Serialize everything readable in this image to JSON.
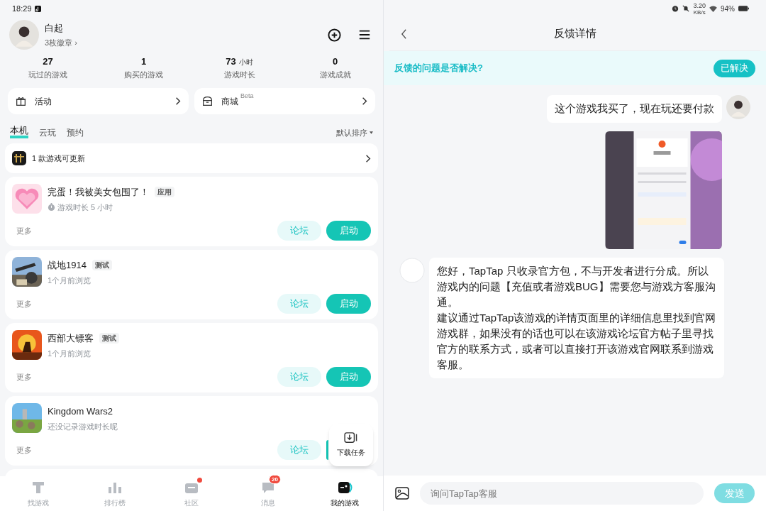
{
  "status_bar": {
    "time": "18:29",
    "speed_value": "3.20",
    "speed_unit": "KB/s",
    "battery": "94%"
  },
  "profile": {
    "name": "白起",
    "badges": "3枚徽章 ›"
  },
  "stats": [
    {
      "value": "27",
      "label": "玩过的游戏"
    },
    {
      "value": "1",
      "label": "购买的游戏"
    },
    {
      "value": "73",
      "unit": "小时",
      "label": "游戏时长"
    },
    {
      "value": "0",
      "label": "游戏成就"
    }
  ],
  "shortcuts": [
    {
      "kind": "gift",
      "label": "活动"
    },
    {
      "kind": "store",
      "label": "商城",
      "tag": "Beta"
    }
  ],
  "tabs": [
    {
      "label": "本机",
      "selected": true
    },
    {
      "label": "云玩",
      "selected": false
    },
    {
      "label": "预约",
      "selected": false
    }
  ],
  "sort": "默认排序",
  "update_banner": "1 款游戏可更新",
  "games": [
    {
      "name": "完蛋！我被美女包围了！",
      "tag": "应用",
      "info": "游戏时长 5 小时",
      "timer": true,
      "more": "更多",
      "forum": "论坛",
      "launch": "启动"
    },
    {
      "name": "战地1914",
      "tag": "测试",
      "info": "1个月前浏览",
      "timer": false,
      "more": "更多",
      "forum": "论坛",
      "launch": "启动"
    },
    {
      "name": "西部大镖客",
      "tag": "测试",
      "info": "1个月前浏览",
      "timer": false,
      "more": "更多",
      "forum": "论坛",
      "launch": "启动"
    },
    {
      "name": "Kingdom Wars2",
      "info": "还没记录游戏时长呢",
      "timer": false,
      "more": "更多",
      "forum": "论坛"
    }
  ],
  "download_tasks": "下载任务",
  "bottom_nav": [
    {
      "kind": "find",
      "label": "找游戏",
      "selected": false
    },
    {
      "kind": "rank",
      "label": "排行榜",
      "selected": false
    },
    {
      "kind": "community",
      "label": "社区",
      "selected": false,
      "dot": true
    },
    {
      "kind": "message",
      "label": "消息",
      "selected": false,
      "count": "20"
    },
    {
      "kind": "mygames",
      "label": "我的游戏",
      "selected": true
    }
  ],
  "feedback": {
    "title": "反馈详情",
    "question": "反馈的问题是否解决?",
    "resolved": "已解决",
    "messages": [
      {
        "kind": "user_text",
        "text": "这个游戏我买了，现在玩还要付款"
      },
      {
        "kind": "user_image"
      },
      {
        "kind": "staff_text",
        "paragraphs": [
          "您好，TapTap 只收录官方包，不与开发者进行分成。所以游戏内的问题【充值或者游戏BUG】需要您与游戏方客服沟通。",
          "建议通过TapTap该游戏的详情页面里的详细信息里找到官网游戏群，如果没有的话也可以在该游戏论坛官方帖子里寻找官方的联系方式，或者可以直接打开该游戏官网联系到游戏客服。"
        ]
      }
    ],
    "input_placeholder": "询问TapTap客服",
    "send": "发送"
  }
}
